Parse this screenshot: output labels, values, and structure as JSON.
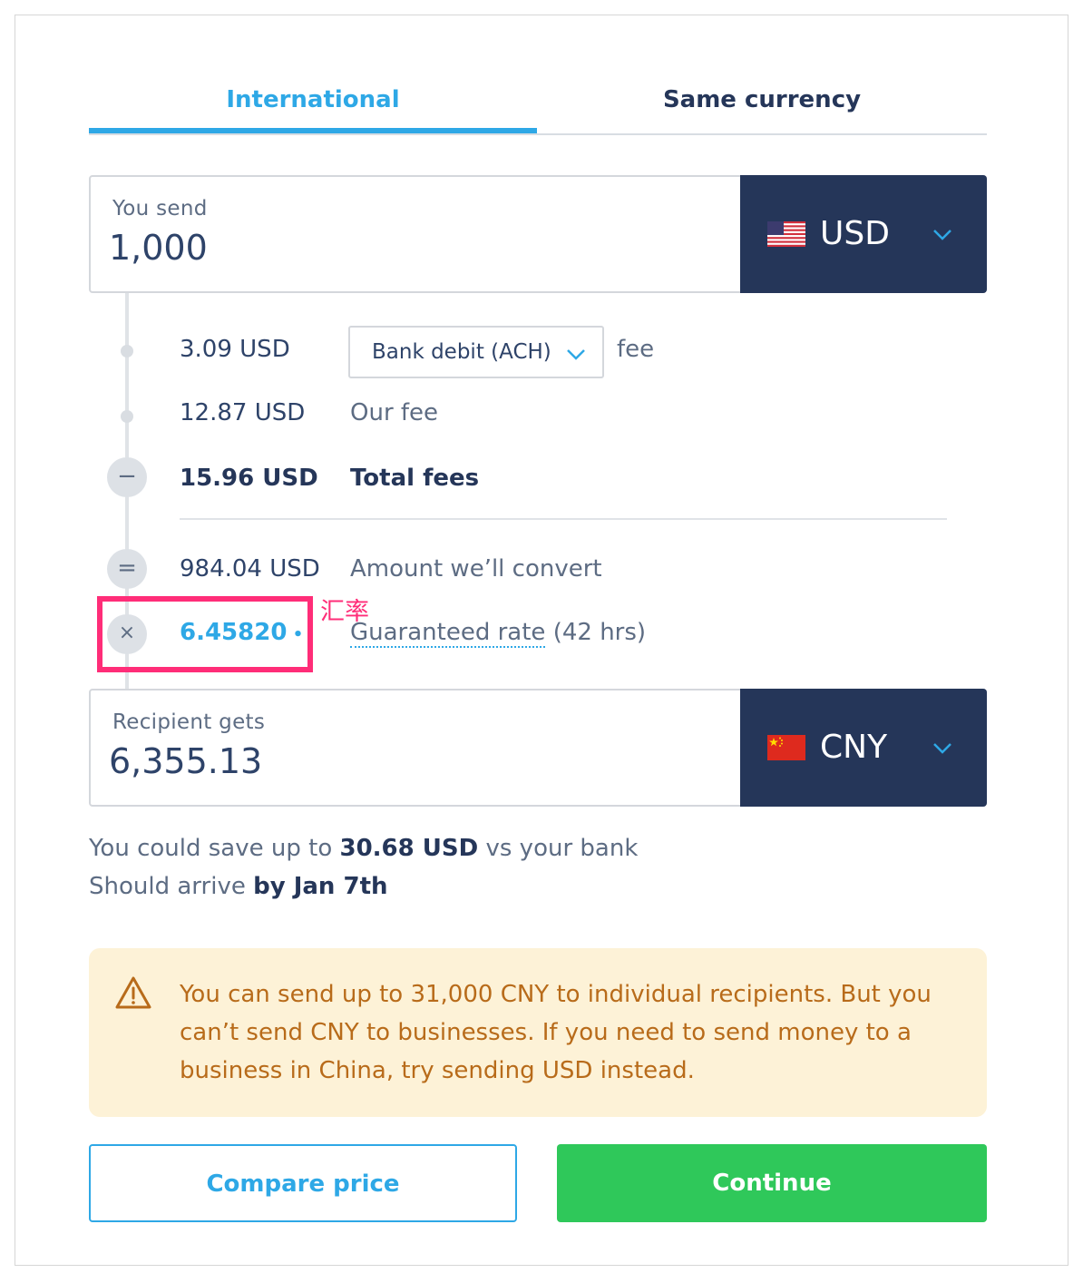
{
  "tabs": [
    {
      "label": "International",
      "active": true
    },
    {
      "label": "Same currency",
      "active": false
    }
  ],
  "send": {
    "label": "You send",
    "value": "1,000",
    "currency": "USD",
    "flag_icon": "us-flag-icon"
  },
  "fees": {
    "method_fee_amount": "3.09 USD",
    "method_select": "Bank debit (ACH)",
    "method_fee_suffix": "fee",
    "our_fee_amount": "12.87 USD",
    "our_fee_label": "Our fee",
    "total_amount": "15.96 USD",
    "total_label": "Total fees",
    "convert_amount": "984.04 USD",
    "convert_label": "Amount we’ll convert",
    "rate": "6.45820",
    "rate_label": "Guaranteed rate",
    "rate_duration": " (42 hrs)",
    "annotation": "汇率"
  },
  "receive": {
    "label": "Recipient gets",
    "value": "6,355.13",
    "currency": "CNY",
    "flag_icon": "cn-flag-icon"
  },
  "savings": {
    "prefix": "You could save up to ",
    "amount": "30.68 USD",
    "suffix": " vs your bank"
  },
  "arrival": {
    "prefix": "Should arrive ",
    "date": "by Jan 7th"
  },
  "warning": {
    "text": "You can send up to 31,000 CNY to individual recipients. But you can’t send CNY to businesses. If you need to send money to a business in China, try sending USD instead."
  },
  "buttons": {
    "compare": "Compare price",
    "continue": "Continue"
  },
  "colors": {
    "accent": "#2ea8e6",
    "navy": "#253659",
    "continue_green": "#2fc85a",
    "warning_bg": "#fdf2d7",
    "warning_text": "#b86b1a",
    "annotation": "#ff2d78"
  }
}
